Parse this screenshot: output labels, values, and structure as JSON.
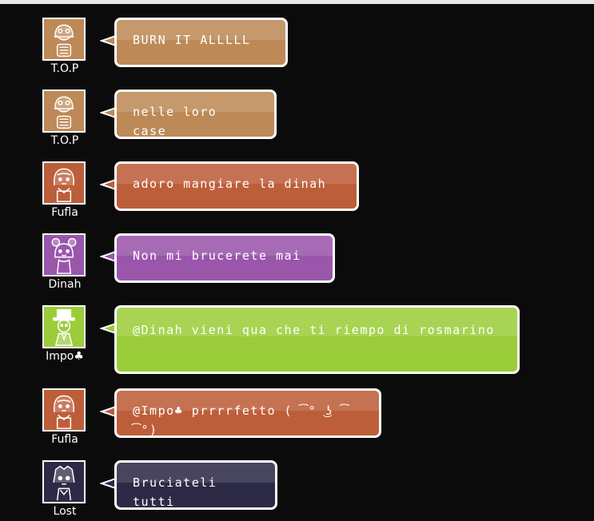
{
  "messages": [
    {
      "user": "T.O.P",
      "text": "BURN IT ALLLLL",
      "color": "#bd8a57",
      "avatar_icon": "top-avatar-icon"
    },
    {
      "user": "T.O.P",
      "text": "nelle loro case",
      "color": "#bd8a57",
      "avatar_icon": "top-avatar-icon"
    },
    {
      "user": "Fufla",
      "text": "adoro mangiare la dinah",
      "color": "#bd5e3a",
      "avatar_icon": "fufla-avatar-icon"
    },
    {
      "user": "Dinah",
      "text": "Non mi brucerete mai",
      "color": "#9a56ab",
      "avatar_icon": "dinah-avatar-icon"
    },
    {
      "user": "Impo♣",
      "text": "@Dinah vieni qua che ti riempo di rosmarino",
      "color": "#9bcd3a",
      "avatar_icon": "impo-avatar-icon"
    },
    {
      "user": "Fufla",
      "text": "@Impo♣ prrrrfetto ( ͡° ͜ʖ ͡°)",
      "color": "#bd5e3a",
      "avatar_icon": "fufla-avatar-icon"
    },
    {
      "user": "Lost",
      "text": "Bruciateli tutti",
      "color": "#2d2a47",
      "avatar_icon": "lost-avatar-icon"
    }
  ]
}
